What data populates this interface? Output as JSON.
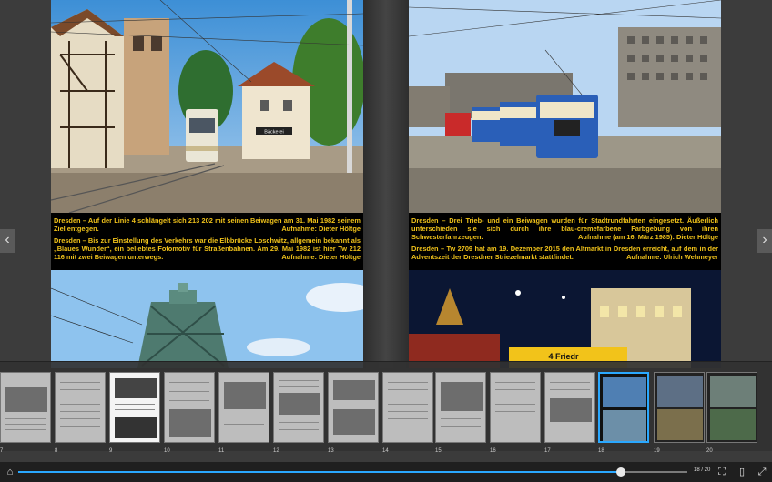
{
  "left_page": {
    "caption_1": "Dresden – Auf der Linie 4 schlängelt sich 213 202 mit seinen Beiwagen am 31. Mai 1982 seinem Ziel entgegen.",
    "credit_1": "Aufnahme: Dieter Höltge",
    "caption_2": "Dresden – Bis zur Einstellung des Verkehrs war die Elbbrücke Loschwitz, allgemein bekannt als „Blaues Wunder“, ein beliebtes Fotomotiv für Straßenbahnen. Am 29. Mai 1982 ist hier Tw 212 116 mit zwei Beiwagen unterwegs.",
    "credit_2": "Aufnahme: Dieter Höltge",
    "shop_sign": "Bäckerei"
  },
  "right_page": {
    "caption_1": "Dresden – Drei Trieb- und ein Beiwagen wurden für Stadtrundfahrten eingesetzt. Äußerlich unterschieden sie sich durch ihre blau-cremefarbene Farbgebung von ihren Schwesterfahrzeugen.",
    "credit_1": "Aufnahme (am 16. März 1985): Dieter Höltge",
    "caption_2": "Dresden – Tw 2709 hat am 19. Dezember 2015 den Altmarkt in Dresden erreicht, auf dem in der Adventszeit der Dresdner Striezelmarkt stattfindet.",
    "credit_2": "Aufnahme: Ulrich Wehmeyer",
    "tram_sign": "4 Friedr"
  },
  "nav": {
    "prev_label": "‹",
    "next_label": "›"
  },
  "thumbnails": {
    "numbers": [
      "7",
      "8",
      "9",
      "10",
      "11",
      "12",
      "13",
      "14",
      "15",
      "16",
      "17",
      "18",
      "19",
      "20"
    ],
    "active_page": "18"
  },
  "bottom_bar": {
    "page_count": "18 / 20",
    "progress": 0.9,
    "home_icon": "home-icon",
    "fit_icon": "fit-page-icon",
    "single_page_icon": "single-page-icon",
    "fullscreen_icon": "fullscreen-icon"
  },
  "colors": {
    "caption_text": "#f0c21a",
    "accent": "#2aa8ff"
  }
}
